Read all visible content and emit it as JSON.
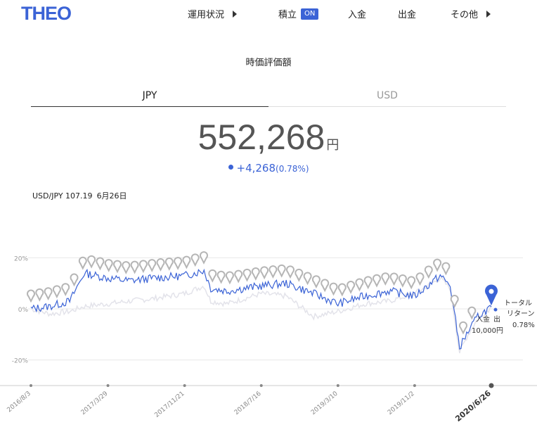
{
  "header": {
    "logo": "THEO",
    "nav": [
      {
        "label": "運用状況",
        "has_caret": true
      },
      {
        "label": "積立",
        "badge": "ON"
      },
      {
        "label": "入金"
      },
      {
        "label": "出金"
      },
      {
        "label": "その他",
        "has_caret": true
      }
    ]
  },
  "section_title": "時価評価額",
  "tabs": [
    {
      "label": "JPY",
      "active": true
    },
    {
      "label": "USD",
      "active": false
    }
  ],
  "valuation": {
    "amount": "552,268",
    "unit": "円"
  },
  "gain": {
    "amount": "+4,268",
    "percent": "(0.78%)"
  },
  "fx": {
    "pair": "USD/JPY 107.19",
    "date": "6月26日"
  },
  "colors": {
    "accent": "#3b63d6",
    "secondary_line": "#e3e3ea",
    "marker": "#b5b5b5"
  },
  "chart_data": {
    "type": "line",
    "yticks": [
      "20%",
      "0%",
      "-20%"
    ],
    "ylim": [
      -30,
      30
    ],
    "xticks": [
      "2016/8/3",
      "2017/3/29",
      "2017/11/21",
      "2018/7/16",
      "2019/3/10",
      "2019/11/2",
      "2020/6/26"
    ],
    "x": [
      "2016/8/3",
      "2016/10/1",
      "2016/12/1",
      "2017/1/15",
      "2017/3/29",
      "2017/6/1",
      "2017/8/15",
      "2017/11/21",
      "2018/1/20",
      "2018/2/10",
      "2018/4/1",
      "2018/7/16",
      "2018/10/1",
      "2018/12/25",
      "2019/3/10",
      "2019/6/1",
      "2019/8/15",
      "2019/11/2",
      "2020/1/20",
      "2020/2/20",
      "2020/3/20",
      "2020/4/15",
      "2020/5/15",
      "2020/6/26"
    ],
    "series": [
      {
        "values": [
          0,
          1,
          3,
          14,
          12,
          11,
          12,
          13,
          15,
          8,
          7,
          9,
          10,
          6,
          2,
          5,
          7,
          5,
          13,
          9,
          -15,
          -9,
          -3,
          0.78
        ]
      },
      {
        "values": [
          0,
          -2,
          -1,
          1,
          2,
          3,
          4,
          6,
          9,
          3,
          2,
          6,
          5,
          -3,
          -1,
          2,
          3,
          6,
          12,
          8,
          -17,
          -10,
          -4,
          0.78
        ]
      }
    ],
    "annotations": [
      {
        "label": "トータル",
        "sublabel": "リターン",
        "value": "0.78%"
      },
      {
        "label": "入金",
        "sublabel": "出",
        "value": "10,000円"
      }
    ]
  }
}
